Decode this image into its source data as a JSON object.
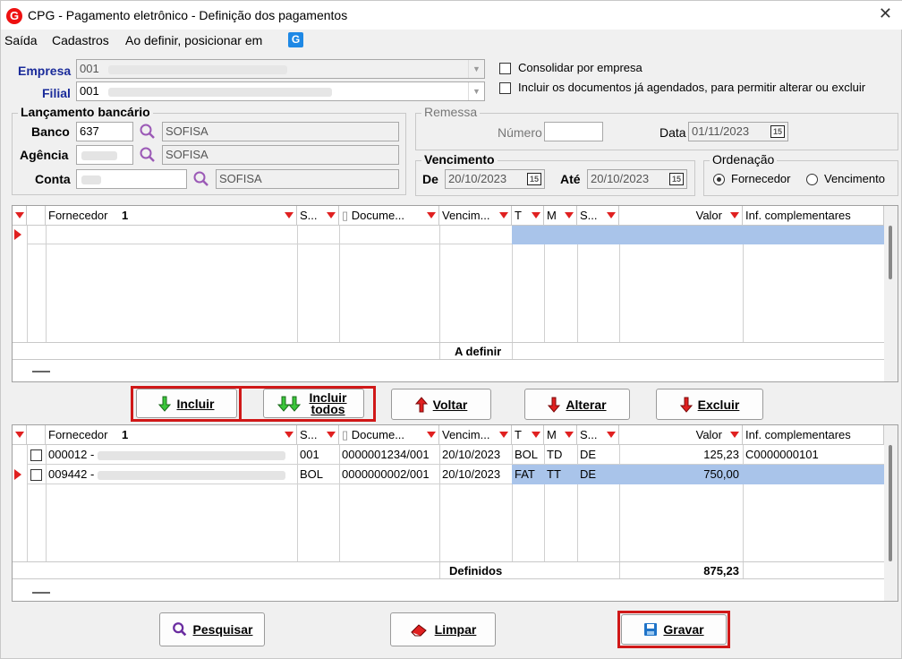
{
  "window": {
    "title": "CPG - Pagamento eletrônico - Definição dos pagamentos",
    "close": "✕"
  },
  "menu": [
    "Saída",
    "Cadastros",
    "Ao definir, posicionar em"
  ],
  "empresa": {
    "label": "Empresa",
    "value": "001"
  },
  "filial": {
    "label": "Filial",
    "value": "001"
  },
  "options": {
    "consolidar": "Consolidar por empresa",
    "incluir_agendados": "Incluir os documentos já agendados, para permitir alterar ou excluir"
  },
  "lancamento": {
    "title": "Lançamento bancário",
    "banco_label": "Banco",
    "banco_value": "637",
    "banco_name": "SOFISA",
    "agencia_label": "Agência",
    "agencia_name": "SOFISA",
    "conta_label": "Conta",
    "conta_name": "SOFISA"
  },
  "remessa": {
    "title": "Remessa",
    "numero_label": "Número",
    "data_label": "Data",
    "data_value": "01/11/2023"
  },
  "vencimento": {
    "title": "Vencimento",
    "de_label": "De",
    "de_value": "20/10/2023",
    "ate_label": "Até",
    "ate_value": "20/10/2023"
  },
  "ordenacao": {
    "title": "Ordenação",
    "fornecedor": "Fornecedor",
    "vencimento": "Vencimento",
    "selected": "Fornecedor"
  },
  "grid_columns": [
    "Fornecedor",
    "S...",
    "Docume...",
    "Vencim...",
    "T",
    "M",
    "S...",
    "Valor",
    "Inf. complementares"
  ],
  "sort_marker": "1",
  "top_grid": {
    "footer_label": "A definir"
  },
  "actions": {
    "incluir": "Incluir",
    "incluir_todos": "Incluir todos",
    "voltar": "Voltar",
    "alterar": "Alterar",
    "excluir": "Excluir"
  },
  "bottom_grid": {
    "rows": [
      {
        "fornecedor": "000012 -",
        "s": "001",
        "documento": "0000001234/001",
        "vencimento": "20/10/2023",
        "t": "BOL",
        "m": "TD",
        "s2": "DE",
        "valor": "125,23",
        "inf": "C0000000101"
      },
      {
        "fornecedor": "009442 -",
        "s": "BOL",
        "documento": "0000000002/001",
        "vencimento": "20/10/2023",
        "t": "FAT",
        "m": "TT",
        "s2": "DE",
        "valor": "750,00",
        "inf": ""
      }
    ],
    "footer_label": "Definidos",
    "footer_total": "875,23"
  },
  "bottom_buttons": {
    "pesquisar": "Pesquisar",
    "limpar": "Limpar",
    "gravar": "Gravar"
  },
  "colors": {
    "accent_red": "#d01818",
    "label_blue": "#1a2b9a",
    "selection": "#a9c4ea"
  }
}
